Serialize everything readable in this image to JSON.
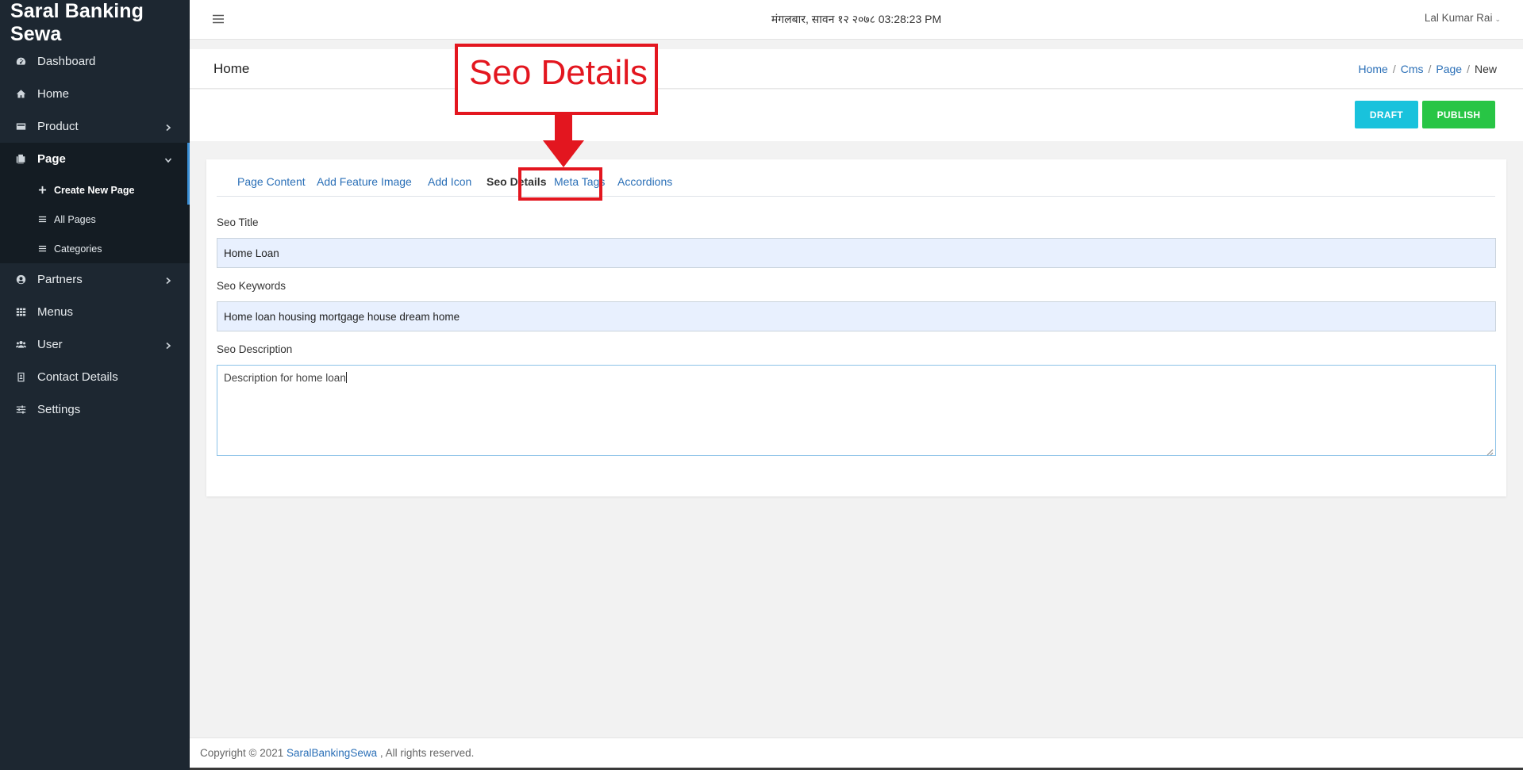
{
  "sidebar": {
    "brand": "Saral Banking Sewa",
    "items": [
      {
        "label": "Dashboard",
        "icon": "dashboard-icon"
      },
      {
        "label": "Home",
        "icon": "home-icon"
      },
      {
        "label": "Product",
        "icon": "product-icon"
      },
      {
        "label": "Page",
        "icon": "page-icon"
      },
      {
        "label": "Partners",
        "icon": "partners-icon"
      },
      {
        "label": "Menus",
        "icon": "menus-icon"
      },
      {
        "label": "User",
        "icon": "user-icon"
      },
      {
        "label": "Contact Details",
        "icon": "contact-icon"
      },
      {
        "label": "Settings",
        "icon": "settings-icon"
      }
    ],
    "page_sub": [
      {
        "label": "Create New Page",
        "icon": "plus-icon"
      },
      {
        "label": "All Pages",
        "icon": "list-icon"
      },
      {
        "label": "Categories",
        "icon": "list-icon"
      }
    ]
  },
  "topbar": {
    "datetime": "मंगलबार, सावन १२ २०७८ 03:28:23 PM",
    "user": "Lal Kumar Rai"
  },
  "header": {
    "title": "Home",
    "breadcrumb": [
      "Home",
      "Cms",
      "Page",
      "New"
    ]
  },
  "actions": {
    "draft": "DRAFT",
    "publish": "PUBLISH"
  },
  "tabs": [
    "Page Content",
    "Add Feature Image",
    "Add Icon",
    "Seo Details",
    "Meta Tags",
    "Accordions"
  ],
  "form": {
    "seo_title_label": "Seo Title",
    "seo_title_value": "Home Loan",
    "seo_keywords_label": "Seo Keywords",
    "seo_keywords_value": "Home loan housing mortgage house dream home",
    "seo_description_label": "Seo Description",
    "seo_description_value": "Description for home loan"
  },
  "footer": {
    "prefix": "Copyright © 2021 ",
    "link": "SaralBankingSewa",
    "suffix": " , All rights reserved."
  },
  "annotation": {
    "label": "Seo Details",
    "color": "#e3161f"
  },
  "colors": {
    "sidebar_bg": "#1d2731",
    "link": "#2a6fb7",
    "draft": "#19c2dc",
    "publish": "#28c545"
  }
}
